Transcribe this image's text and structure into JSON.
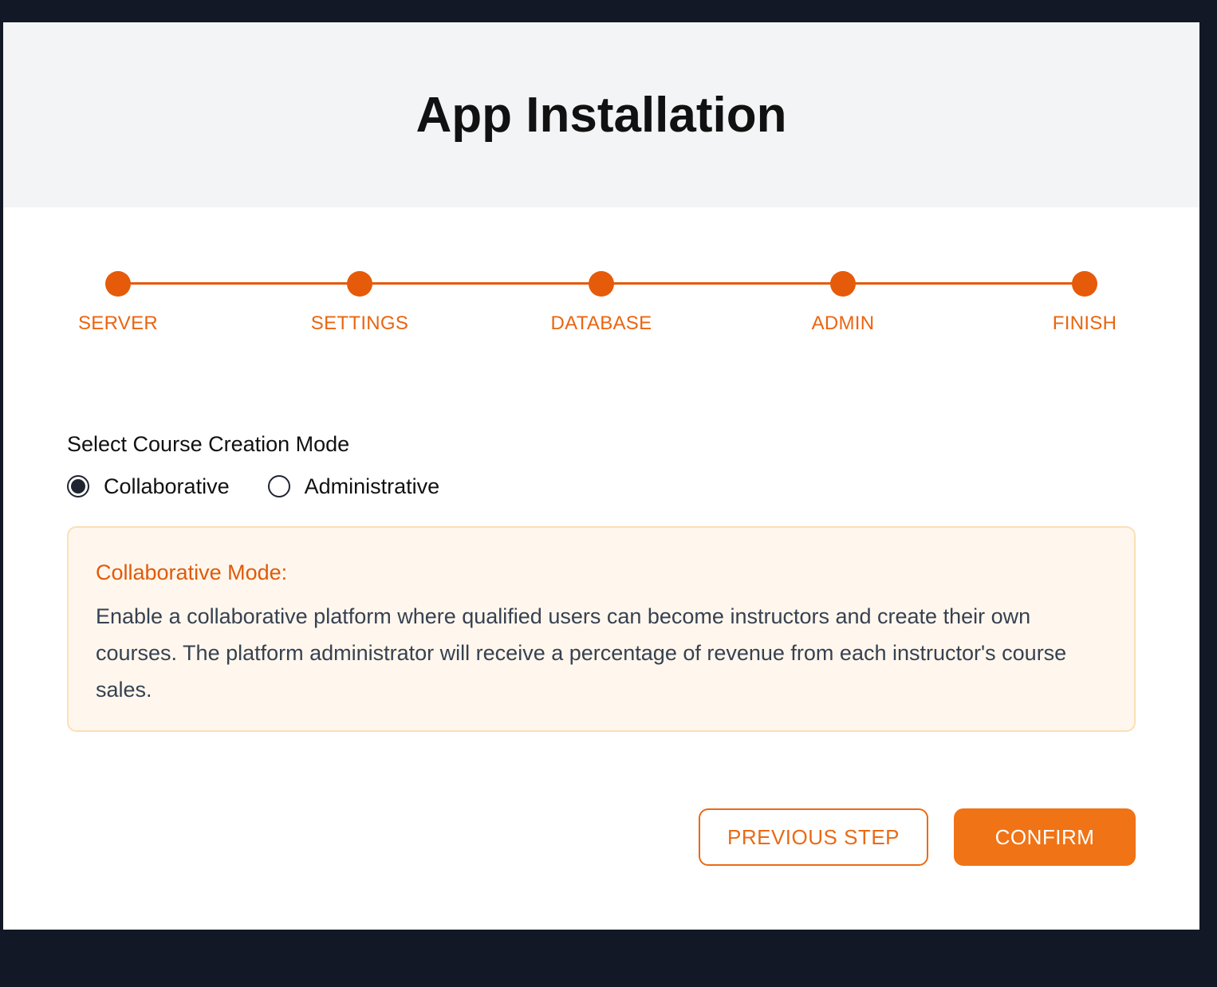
{
  "header": {
    "title": "App Installation"
  },
  "stepper": {
    "accent_color": "#e55b0a",
    "steps": [
      {
        "label": "SERVER"
      },
      {
        "label": "SETTINGS"
      },
      {
        "label": "DATABASE"
      },
      {
        "label": "ADMIN"
      },
      {
        "label": "FINISH"
      }
    ]
  },
  "form": {
    "label": "Select Course Creation Mode",
    "options": [
      {
        "label": "Collaborative",
        "selected": true
      },
      {
        "label": "Administrative",
        "selected": false
      }
    ]
  },
  "info": {
    "title": "Collaborative Mode:",
    "text": "Enable a collaborative platform where qualified users can become instructors and create their own courses. The platform administrator will receive a percentage of revenue from each instructor's course sales."
  },
  "actions": {
    "previous_label": "PREVIOUS STEP",
    "confirm_label": "CONFIRM",
    "primary_color": "#f07316"
  }
}
